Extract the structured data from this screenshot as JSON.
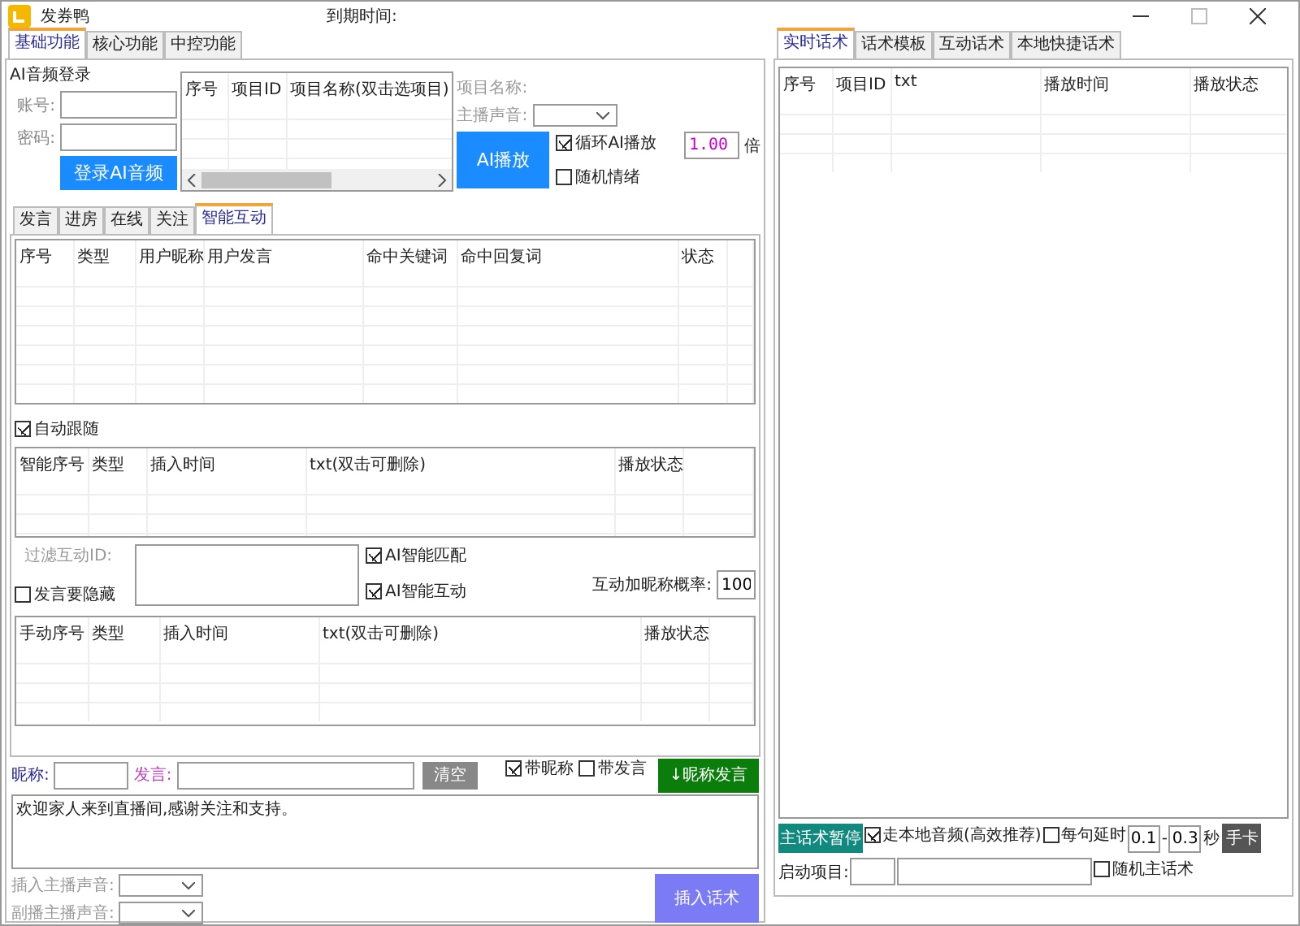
{
  "window": {
    "title": "发券鸭",
    "expire_label": "到期时间:"
  },
  "main_tabs": [
    {
      "label": "基础功能",
      "selected": true
    },
    {
      "label": "核心功能",
      "selected": false
    },
    {
      "label": "中控功能",
      "selected": false
    }
  ],
  "login": {
    "title": "AI音频登录",
    "account_label": "账号:",
    "password_label": "密码:",
    "button": "登录AI音频"
  },
  "project_table": {
    "columns": [
      "序号",
      "项目ID",
      "项目名称(双击选项目)"
    ]
  },
  "project": {
    "name_label": "项目名称:",
    "voice_label": "主播声音:",
    "play_button": "AI播放",
    "loop": {
      "label": "循环AI播放",
      "checked": true
    },
    "speed": "1.00",
    "speed_unit": "倍",
    "random_mood": {
      "label": "随机情绪",
      "checked": false
    }
  },
  "sub_tabs": [
    {
      "label": "发言",
      "selected": false
    },
    {
      "label": "进房",
      "selected": false
    },
    {
      "label": "在线",
      "selected": false
    },
    {
      "label": "关注",
      "selected": false
    },
    {
      "label": "智能互动",
      "selected": true
    }
  ],
  "interaction_table": {
    "columns": [
      "序号",
      "类型",
      "用户昵称",
      "用户发言",
      "命中关键词",
      "命中回复词",
      "状态"
    ]
  },
  "auto_follow": {
    "label": "自动跟随",
    "checked": true
  },
  "smart_table": {
    "columns": [
      "智能序号",
      "类型",
      "插入时间",
      "txt(双击可删除)",
      "播放状态"
    ]
  },
  "filter": {
    "label": "过滤互动ID:",
    "hide_speech": {
      "label": "发言要隐藏",
      "checked": false
    }
  },
  "ai_match": {
    "label": "AI智能匹配",
    "checked": true
  },
  "ai_interact": {
    "label": "AI智能互动",
    "checked": true
  },
  "nickname_rate": {
    "label": "互动加昵称概率:",
    "value": "100"
  },
  "manual_table": {
    "columns": [
      "手动序号",
      "类型",
      "插入时间",
      "txt(双击可删除)",
      "播放状态"
    ]
  },
  "compose": {
    "nickname_label": "昵称:",
    "speech_label": "发言:",
    "clear_button": "清空",
    "with_nickname": {
      "label": "带昵称",
      "checked": true
    },
    "with_speech": {
      "label": "带发言",
      "checked": false
    },
    "send_button": "↓昵称发言"
  },
  "message": "欢迎家人来到直播间,感谢关注和支持。",
  "insert_voice_label": "插入主播声音:",
  "sub_voice_label": "副播主播声音:",
  "insert_button": "插入话术",
  "right_tabs": [
    {
      "label": "实时话术",
      "selected": true
    },
    {
      "label": "话术模板",
      "selected": false
    },
    {
      "label": "互动话术",
      "selected": false
    },
    {
      "label": "本地快捷话术",
      "selected": false
    }
  ],
  "live_table": {
    "columns": [
      "序号",
      "项目ID",
      "txt",
      "播放时间",
      "播放状态"
    ]
  },
  "playback": {
    "pause_button": "主话术暂停",
    "local_audio": {
      "label": "走本地音频(高效推荐)",
      "checked": true
    },
    "delay": {
      "label": "每句延时",
      "checked": false
    },
    "delay_min": "0.1",
    "dash": "-",
    "delay_max": "0.3",
    "unit": "秒",
    "card_button": "手卡",
    "start_label": "启动项目:",
    "random_main": {
      "label": "随机主话术",
      "checked": false
    }
  }
}
